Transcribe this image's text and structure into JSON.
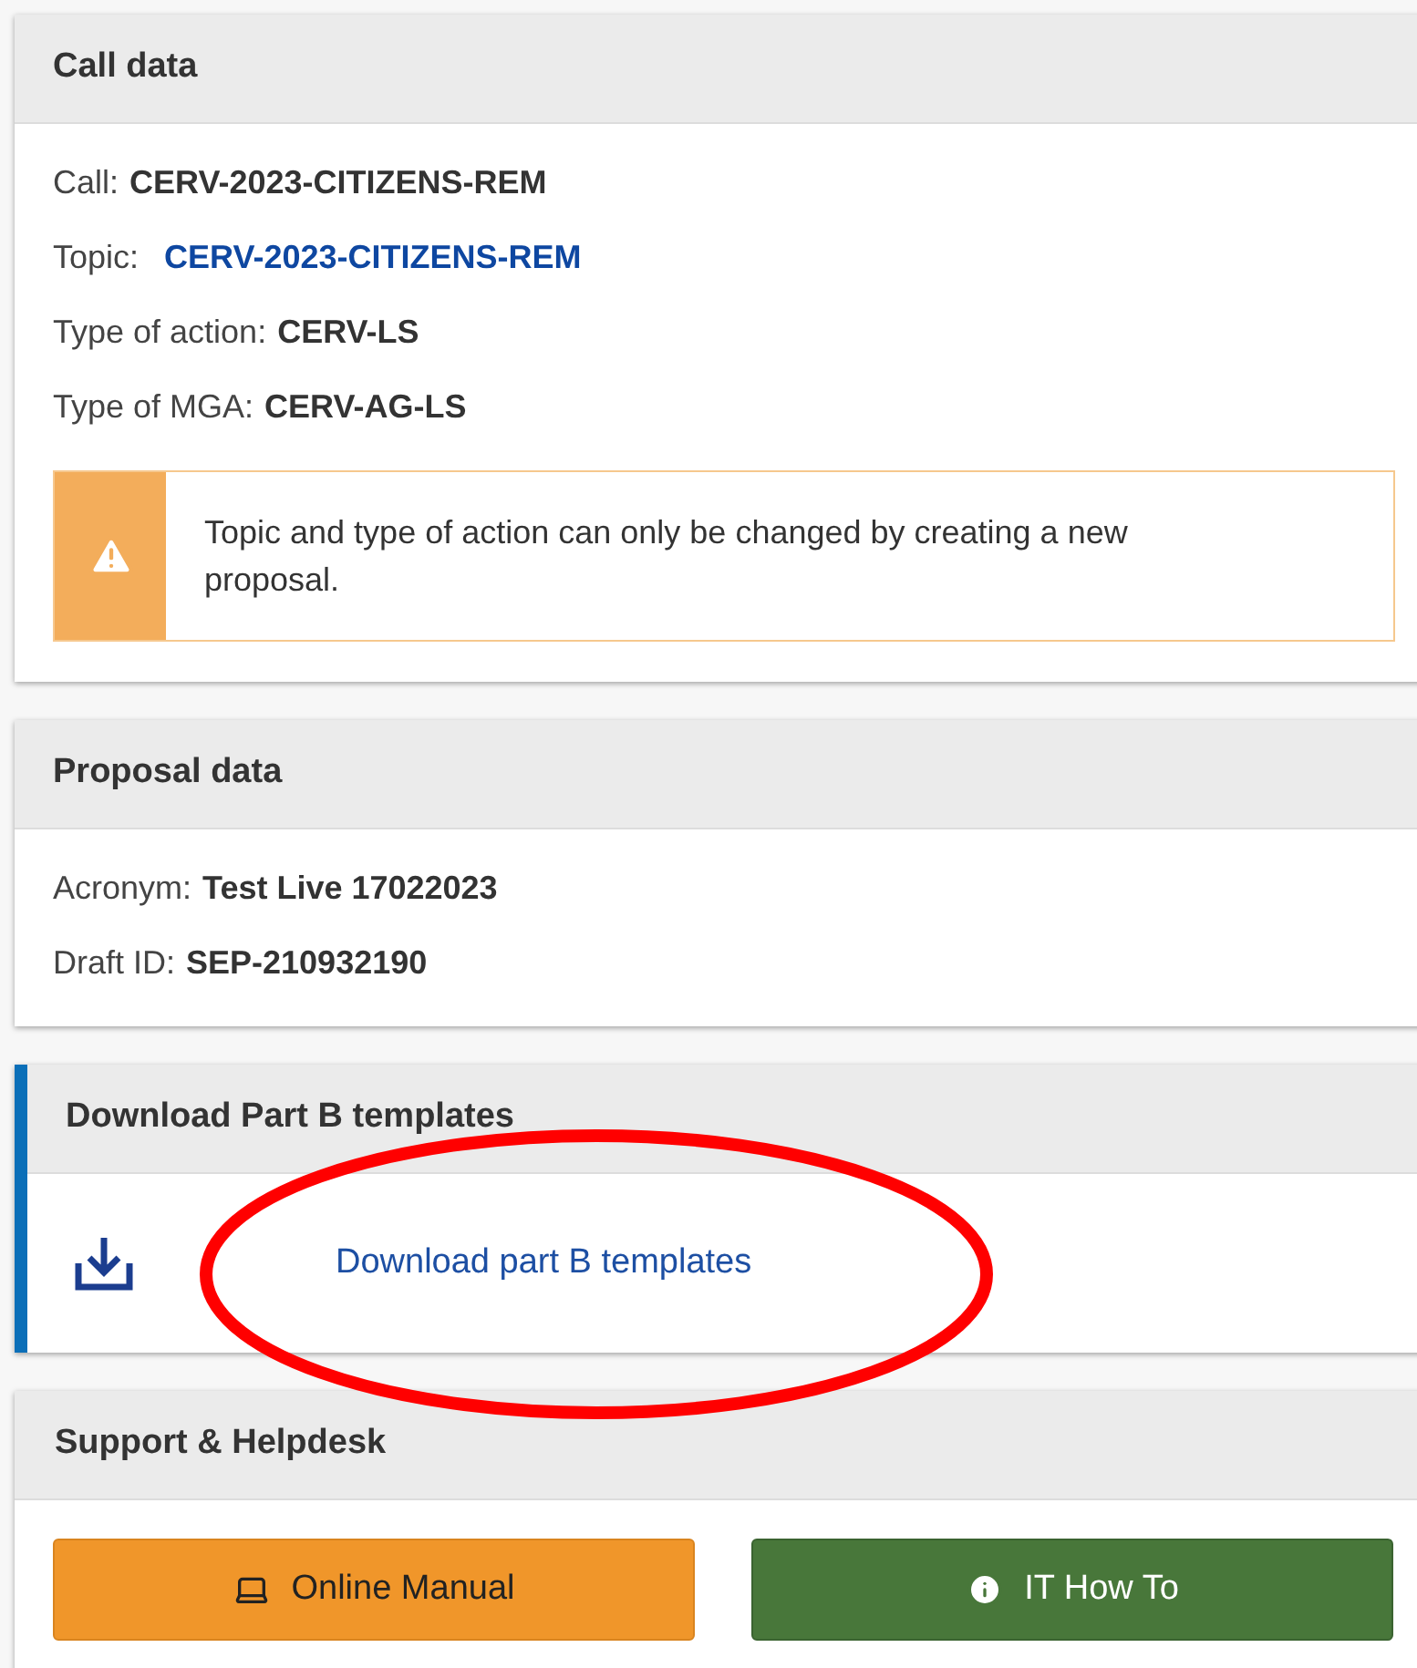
{
  "call_data": {
    "title": "Call data",
    "fields": [
      {
        "kind": "text",
        "label": "Call:",
        "value": "CERV-2023-CITIZENS-REM"
      },
      {
        "kind": "link",
        "label": "Topic:",
        "value": "CERV-2023-CITIZENS-REM"
      },
      {
        "kind": "text",
        "label": "Type of action:",
        "value": "CERV-LS"
      },
      {
        "kind": "text",
        "label": "Type of MGA:",
        "value": "CERV-AG-LS"
      }
    ],
    "warning": "Topic and type of action can only be changed by creating a new proposal."
  },
  "proposal_data": {
    "title": "Proposal data",
    "fields": [
      {
        "kind": "text",
        "label": "Acronym:",
        "value": "Test Live 17022023"
      },
      {
        "kind": "text",
        "label": "Draft ID:",
        "value": "SEP-210932190"
      }
    ]
  },
  "templates": {
    "title": "Download Part B templates",
    "link": "Download part B templates"
  },
  "annotation": {
    "kind": "ellipse"
  },
  "support": {
    "title": "Support & Helpdesk",
    "buttons": [
      {
        "kind": "manual",
        "label": "Online Manual"
      },
      {
        "kind": "howto",
        "label": "IT How To"
      }
    ]
  }
}
